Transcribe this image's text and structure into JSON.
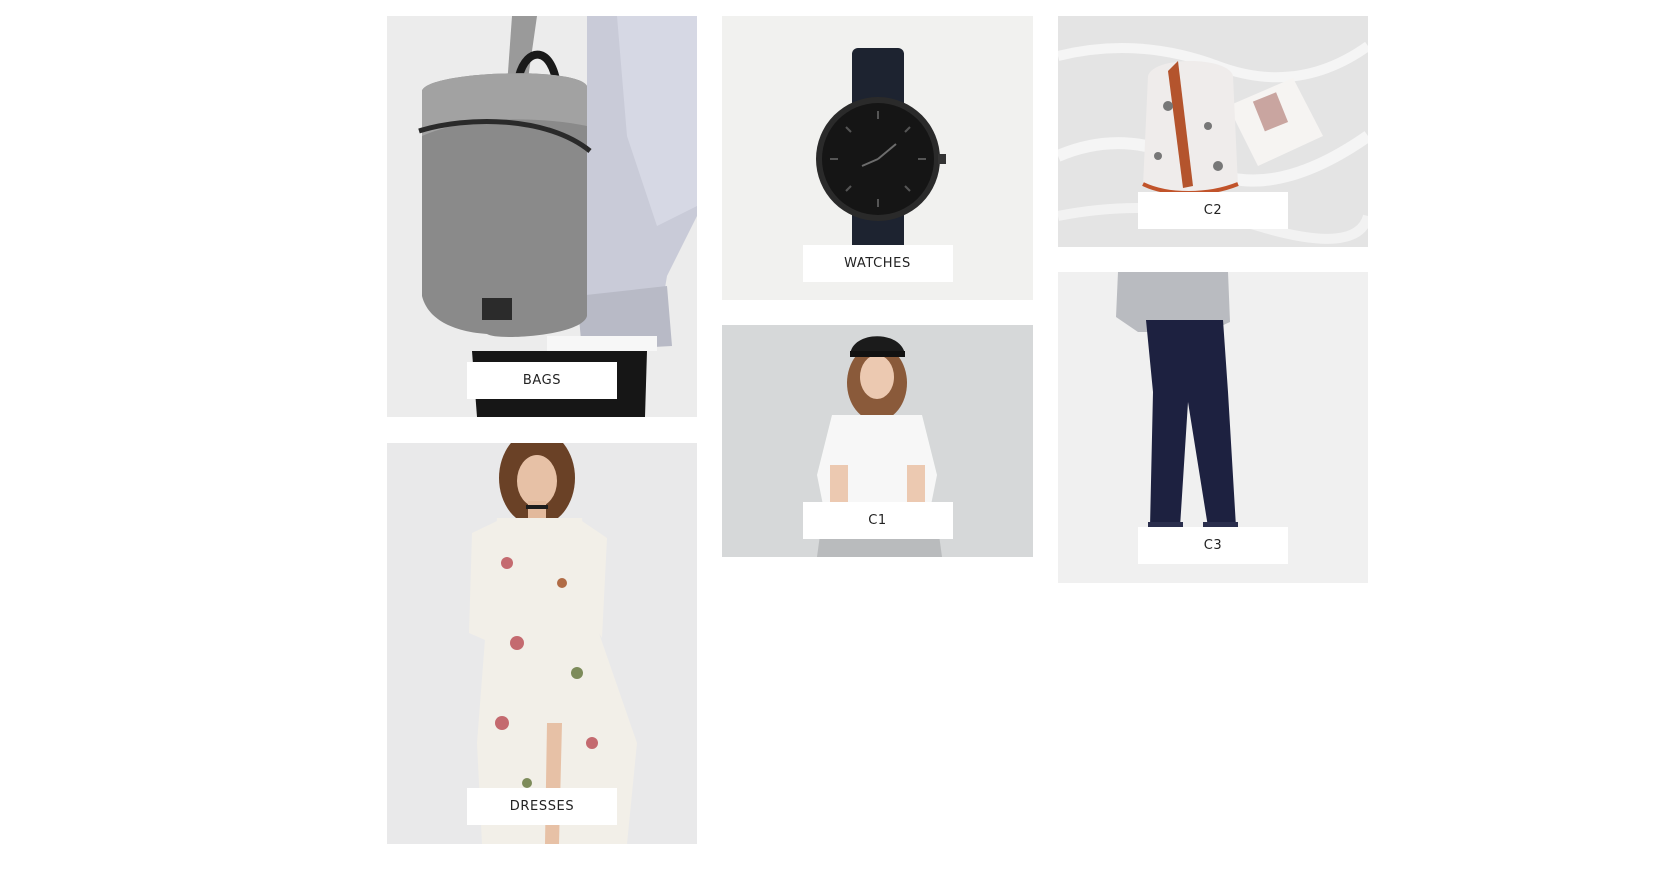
{
  "categories": [
    {
      "id": "bags",
      "label": "BAGS",
      "image": "backpack-photo"
    },
    {
      "id": "dresses",
      "label": "DRESSES",
      "image": "floral-dress-photo"
    },
    {
      "id": "watches",
      "label": "WATCHES",
      "image": "watch-photo"
    },
    {
      "id": "c1",
      "label": "C1",
      "image": "tshirt-cap-photo"
    },
    {
      "id": "c2",
      "label": "C2",
      "image": "floral-backpack-photo"
    },
    {
      "id": "c3",
      "label": "C3",
      "image": "navy-joggers-photo"
    }
  ],
  "colors": {
    "page_background": "#ffffff",
    "tile_background": "#f0efed",
    "label_background": "#ffffff",
    "label_text": "#222222"
  }
}
